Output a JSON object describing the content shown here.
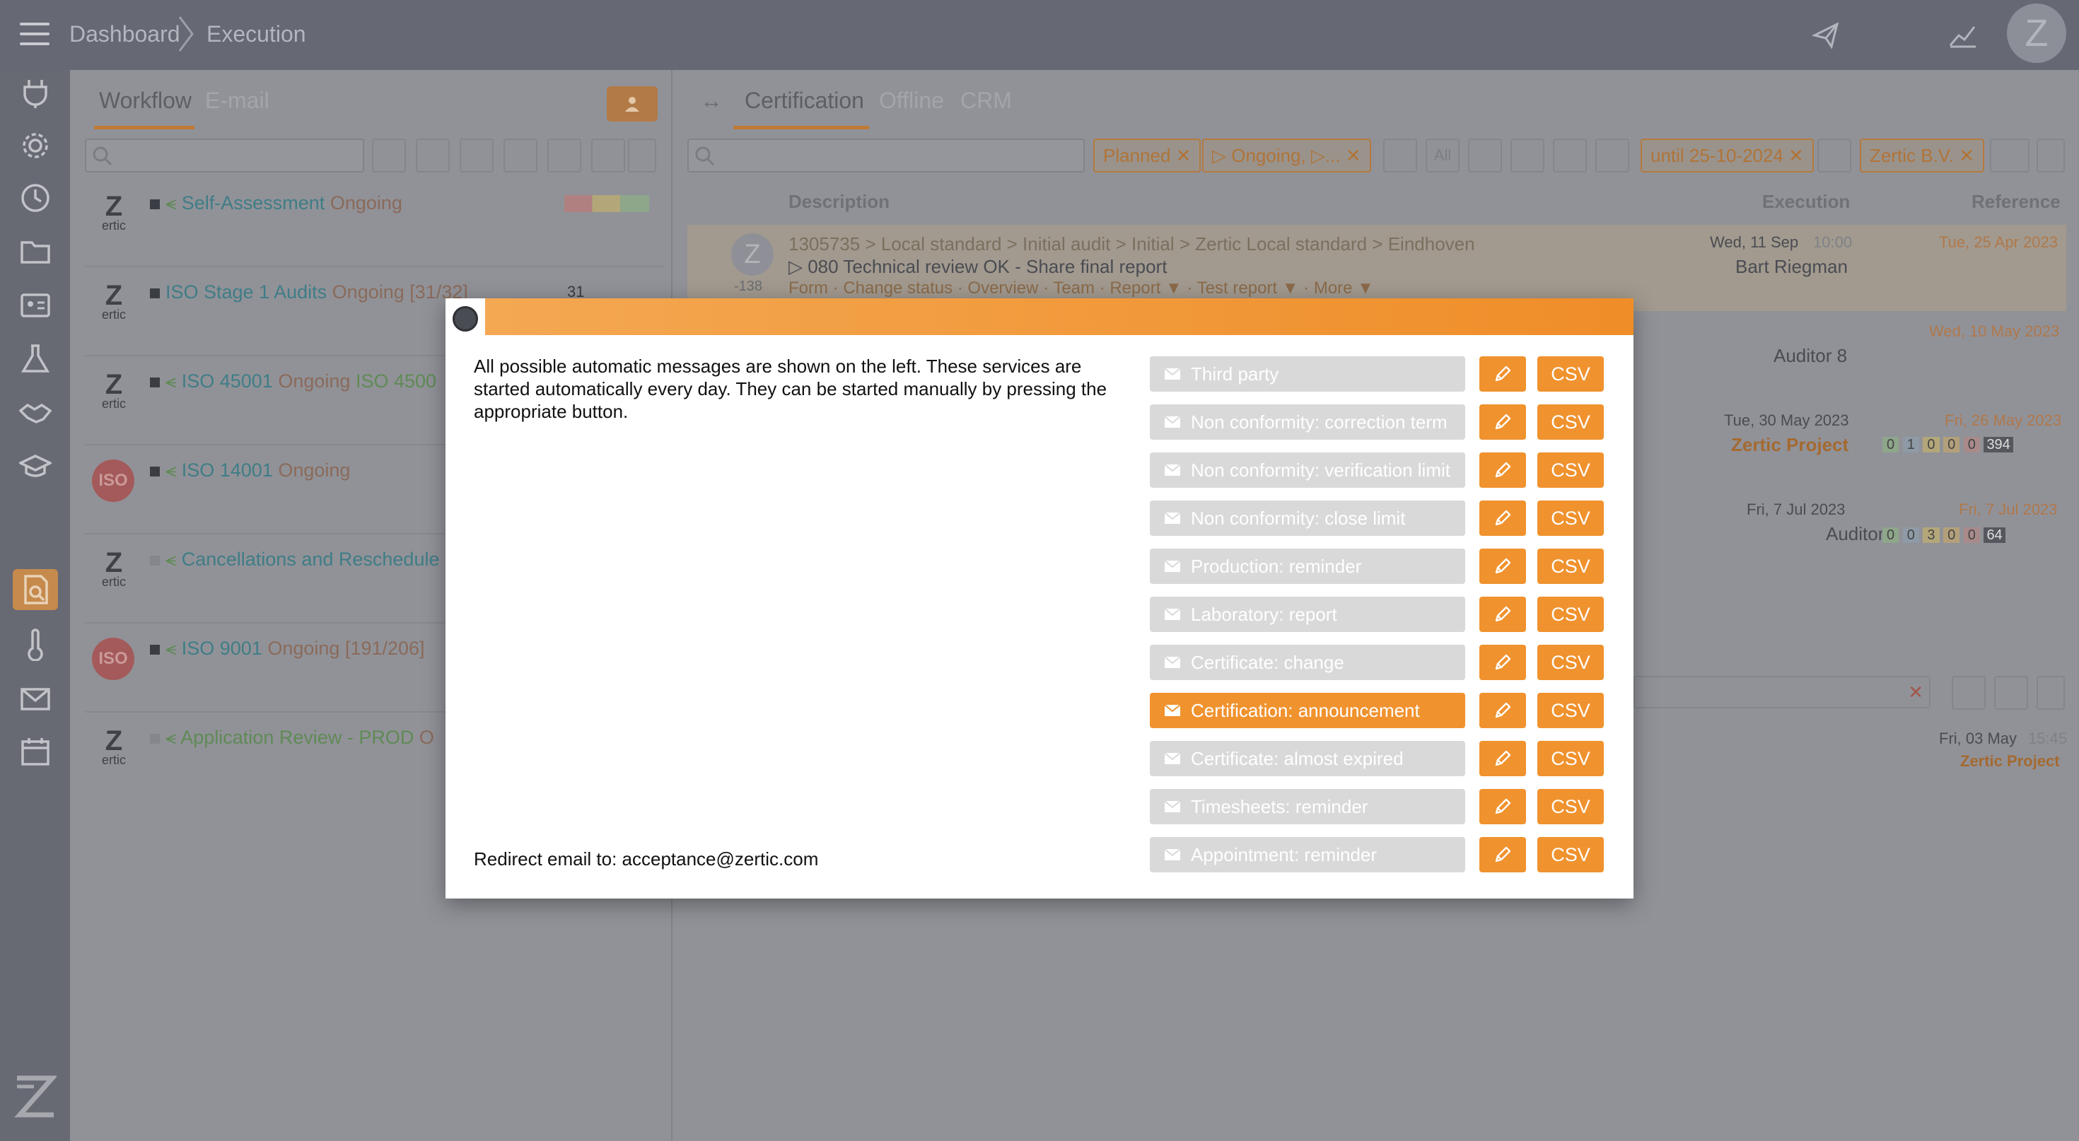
{
  "header": {
    "breadcrumb": [
      "Dashboard",
      "Execution"
    ],
    "avatar_letter": "Z"
  },
  "left_panel": {
    "tabs": [
      "Workflow",
      "E-mail"
    ],
    "workflows": [
      {
        "name": "Self-Assessment",
        "status": "Ongoing",
        "extra": "",
        "logo": "Z",
        "logo_sub": "ertic"
      },
      {
        "name": "ISO Stage 1 Audits",
        "status": "Ongoing",
        "extra": "[31/32]",
        "logo": "Z",
        "logo_sub": "ertic"
      },
      {
        "name": "ISO 45001",
        "status": "Ongoing",
        "extra": "ISO 4500",
        "logo": "Z",
        "logo_sub": "ertic"
      },
      {
        "name": "ISO 14001",
        "status": "Ongoing",
        "extra": "",
        "logo": "ISO",
        "logo_sub": ""
      },
      {
        "name": "Cancellations and Reschedule",
        "status": "",
        "extra": "",
        "logo": "Z",
        "logo_sub": "ertic"
      },
      {
        "name": "ISO 9001",
        "status": "Ongoing",
        "extra": "[191/206]",
        "logo": "ISO",
        "logo_sub": ""
      },
      {
        "name": "Application Review - PROD",
        "status": "O",
        "extra": "",
        "logo": "Z",
        "logo_sub": "ertic"
      }
    ],
    "badge_count": "31"
  },
  "right_panel": {
    "tabs": [
      "Certification",
      "Offline",
      "CRM"
    ],
    "filter_chips": [
      "Planned",
      "▷ Ongoing, ▷...",
      "All",
      "until 25-10-2024",
      "Zertic B.V."
    ],
    "columns": [
      "Description",
      "Execution",
      "Reference"
    ],
    "row1": {
      "path": "1305735 > Local standard > Initial audit > Initial > Zertic Local standard > Eindhoven",
      "step": "▷ 080 Technical review OK - Share final report",
      "actions": "Form · Change status · Overview · Team · Report ▼ · Test report ▼ · More ▼",
      "date": "Wed, 11 Sep",
      "time": "10:00",
      "person": "Bart Riegman",
      "ref_date": "Tue, 25 Apr 2023",
      "avatar": "Z",
      "count": "-138"
    },
    "row2": {
      "person": "Auditor 8",
      "ref_date": "Wed, 10 May 2023"
    },
    "row3": {
      "date": "Tue, 30 May 2023",
      "person": "Zertic Project",
      "ref_date": "Fri, 26 May 2023",
      "counts": [
        "0",
        "1",
        "0",
        "0",
        "0",
        "394"
      ]
    },
    "row4": {
      "date": "Fri, 7 Jul 2023",
      "person": "Auditor",
      "ref_date": "Fri, 7 Jul 2023",
      "counts": [
        "0",
        "0",
        "3",
        "0",
        "0",
        "64"
      ]
    },
    "row5": {
      "date": "Fri, 03 May",
      "time": "15:45",
      "person": "Zertic Project"
    }
  },
  "modal": {
    "description": "All possible automatic messages are shown on the left. These services are started automatically every day. They can be started manually by pressing the appropriate button.",
    "redirect": "Redirect email to: acceptance@zertic.com",
    "services": [
      {
        "label": "Third party",
        "active": false
      },
      {
        "label": "Non conformity: correction term",
        "active": false
      },
      {
        "label": "Non conformity: verification limit",
        "active": false
      },
      {
        "label": "Non conformity: close limit",
        "active": false
      },
      {
        "label": "Production: reminder",
        "active": false
      },
      {
        "label": "Laboratory: report",
        "active": false
      },
      {
        "label": "Certificate: change",
        "active": false
      },
      {
        "label": "Certification: announcement",
        "active": true
      },
      {
        "label": "Certificate: almost expired",
        "active": false
      },
      {
        "label": "Timesheets: reminder",
        "active": false
      },
      {
        "label": "Appointment: reminder",
        "active": false
      }
    ],
    "csv_label": "CSV"
  },
  "colors": {
    "accent": "#f0922e",
    "overlay": "#8f9097",
    "topbar": "#666874"
  }
}
